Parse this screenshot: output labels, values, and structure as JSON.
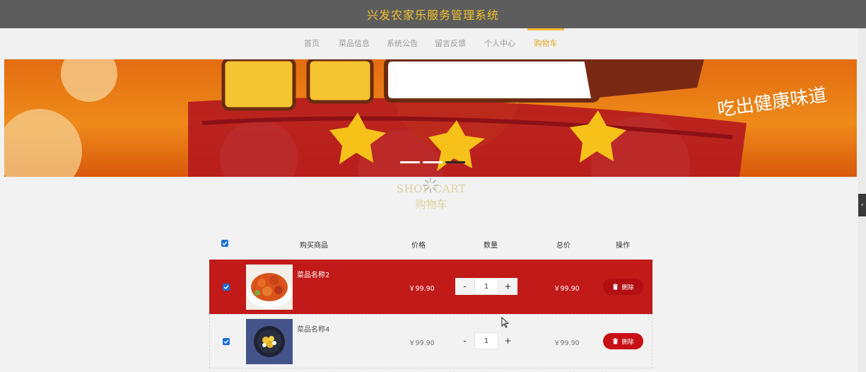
{
  "header": {
    "title": "兴发农家乐服务管理系统"
  },
  "nav": {
    "items": [
      {
        "label": "首页"
      },
      {
        "label": "菜品信息"
      },
      {
        "label": "系统公告"
      },
      {
        "label": "留言反馈"
      },
      {
        "label": "个人中心"
      },
      {
        "label": "购物车"
      }
    ],
    "active": "购物车"
  },
  "section": {
    "title_en": "SHOP CART",
    "title_cn": "购物车"
  },
  "cart": {
    "headers": {
      "product": "购买商品",
      "price": "价格",
      "quantity": "数量",
      "total": "总价",
      "action": "操作"
    },
    "all_selected": true,
    "rows": [
      {
        "name": "菜品名称2",
        "price": "￥99.90",
        "qty": "1",
        "total": "￥99.90",
        "delete_label": "删除",
        "checked": true,
        "highlighted": true
      },
      {
        "name": "菜品名称4",
        "price": "￥99.90",
        "qty": "1",
        "total": "￥99.90",
        "delete_label": "删除",
        "checked": true,
        "highlighted": false
      }
    ],
    "minus_label": "-",
    "plus_label": "+"
  },
  "colors": {
    "accent": "#f0b830",
    "danger": "#c80f16",
    "checkbox": "#1a6fd6",
    "topbar": "#5d5d5d"
  },
  "icons": {
    "delete": "trash-icon",
    "loading": "spinner-icon",
    "side_toggle": "chevron-left-icon",
    "checkbox": "check-icon"
  }
}
